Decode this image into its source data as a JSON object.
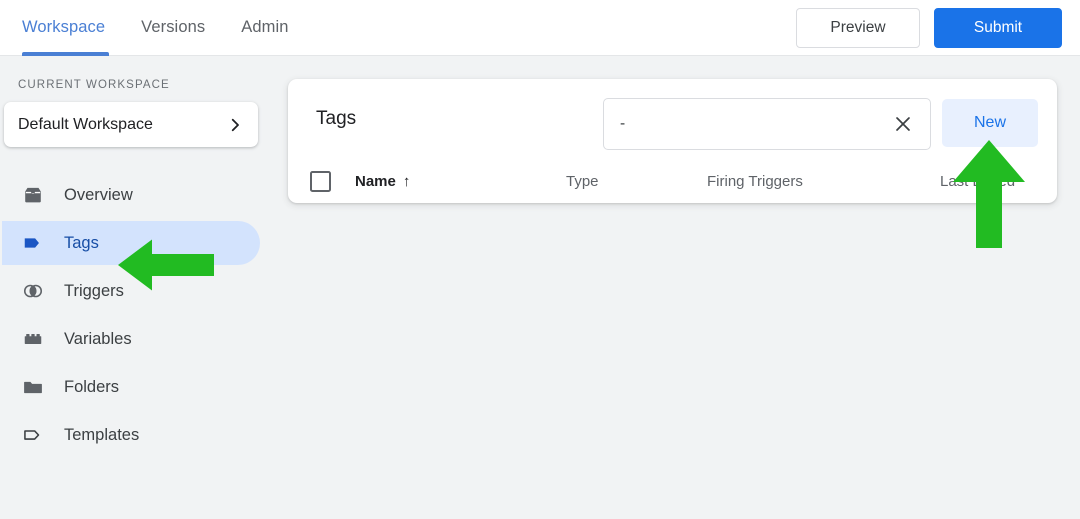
{
  "topbar": {
    "tabs": [
      {
        "label": "Workspace",
        "active": true
      },
      {
        "label": "Versions",
        "active": false
      },
      {
        "label": "Admin",
        "active": false
      }
    ],
    "preview_label": "Preview",
    "submit_label": "Submit",
    "active_color": "#4a7fd4",
    "submit_color": "#1a73e8"
  },
  "sidebar": {
    "section_label": "CURRENT WORKSPACE",
    "workspace_name": "Default Workspace",
    "chevron_icon": "chevron-right-icon",
    "items": [
      {
        "label": "Overview",
        "icon": "inbox-icon",
        "selected": false
      },
      {
        "label": "Tags",
        "icon": "tag-icon",
        "selected": true
      },
      {
        "label": "Triggers",
        "icon": "venn-icon",
        "selected": false
      },
      {
        "label": "Variables",
        "icon": "brick-icon",
        "selected": false
      },
      {
        "label": "Folders",
        "icon": "folder-icon",
        "selected": false
      },
      {
        "label": "Templates",
        "icon": "tag-outline-icon",
        "selected": false
      }
    ],
    "selected_pill_color": "#d3e3fd",
    "selected_text_color": "#174ea6"
  },
  "main": {
    "card_title": "Tags",
    "search": {
      "value": "-",
      "placeholder": "",
      "clear_icon": "close-icon"
    },
    "new_button": {
      "label": "New",
      "background": "#e8f0fe",
      "text_color": "#1a73e8"
    },
    "table": {
      "select_all_icon": "checkbox-unchecked-icon",
      "columns": [
        {
          "label": "Name",
          "sort": "↑"
        },
        {
          "label": "Type"
        },
        {
          "label": "Firing Triggers"
        },
        {
          "label": "Last Edited"
        }
      ],
      "rows": []
    }
  },
  "annotations": {
    "color": "#22bb22",
    "arrows": [
      {
        "name": "arrow-pointing-to-tags",
        "direction": "left"
      },
      {
        "name": "arrow-pointing-to-new-button",
        "direction": "up"
      }
    ]
  }
}
